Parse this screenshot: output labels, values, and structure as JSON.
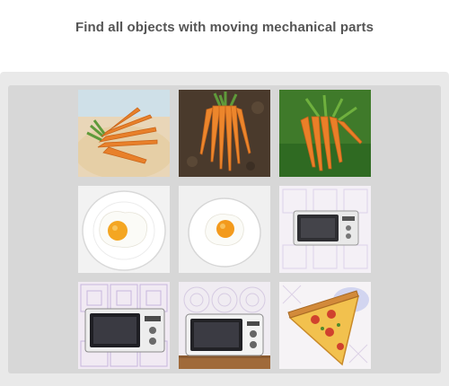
{
  "prompt": {
    "text": "Find all objects with moving mechanical parts"
  },
  "grid": {
    "tiles": [
      {
        "subject": "carrots on sand",
        "icon": "carrots-on-beach-image"
      },
      {
        "subject": "carrots on soil",
        "icon": "carrots-on-soil-image"
      },
      {
        "subject": "carrots on grass",
        "icon": "carrots-on-grass-image"
      },
      {
        "subject": "fried egg on plate",
        "icon": "fried-egg-plate-image"
      },
      {
        "subject": "fried egg on plate",
        "icon": "fried-egg-plate-image"
      },
      {
        "subject": "microwave oven",
        "icon": "microwave-image"
      },
      {
        "subject": "microwave oven",
        "icon": "microwave-image"
      },
      {
        "subject": "microwave oven",
        "icon": "microwave-image"
      },
      {
        "subject": "pizza slice",
        "icon": "pizza-slice-image"
      }
    ]
  },
  "colors": {
    "prompt_text": "#555555",
    "outer_panel": "#e9e9e9",
    "inner_panel": "#d7d7d7",
    "carrot": "#e8802a",
    "carrot_leaf": "#4f8a2c",
    "egg_yolk": "#f4a622",
    "microwave_body": "#e8e8e8",
    "pizza_cheese": "#f2c14e"
  }
}
